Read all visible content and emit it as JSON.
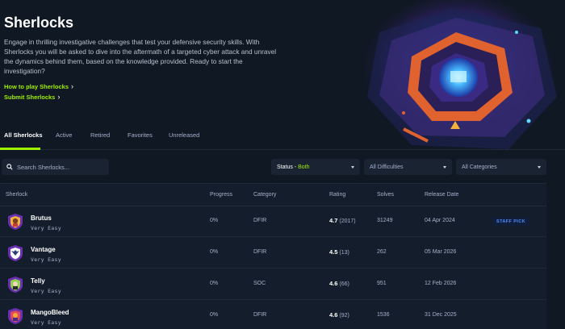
{
  "hero": {
    "title": "Sherlocks",
    "description": "Engage in thrilling investigative challenges that test your defensive security skills. With Sherlocks you will be asked to dive into the aftermath of a targeted cyber attack and unravel the dynamics behind them, based on the knowledge provided. Ready to start the investigation?",
    "links": [
      {
        "label": "How to play Sherlocks"
      },
      {
        "label": "Submit Sherlocks"
      }
    ]
  },
  "tabs": [
    {
      "label": "All Sherlocks",
      "active": true
    },
    {
      "label": "Active"
    },
    {
      "label": "Retired"
    },
    {
      "label": "Favorites"
    },
    {
      "label": "Unreleased"
    }
  ],
  "filters": {
    "search_placeholder": "Search Sherlocks...",
    "status_label": "Status",
    "status_separator": " - ",
    "status_value": "Both",
    "difficulty": "All Difficulties",
    "category": "All Categories"
  },
  "table": {
    "columns": [
      "Sherlock",
      "Progress",
      "Category",
      "Rating",
      "Solves",
      "Release Date"
    ],
    "rows": [
      {
        "name": "Brutus",
        "difficulty": "Very Easy",
        "progress": "0%",
        "category": "DFIR",
        "rating": "4.7",
        "rating_count": "(2017)",
        "solves": "31249",
        "release": "04 Apr 2024",
        "badge": "STAFF PICK",
        "avatar_color": "#6b2fb3"
      },
      {
        "name": "Vantage",
        "difficulty": "Very Easy",
        "progress": "0%",
        "category": "DFIR",
        "rating": "4.5",
        "rating_count": "(13)",
        "solves": "262",
        "release": "05 Mar 2026",
        "avatar_color": "#6b2fb3"
      },
      {
        "name": "Telly",
        "difficulty": "Very Easy",
        "progress": "0%",
        "category": "SOC",
        "rating": "4.6",
        "rating_count": "(66)",
        "solves": "951",
        "release": "12 Feb 2026",
        "avatar_color": "#6b2fb3"
      },
      {
        "name": "MangoBleed",
        "difficulty": "Very Easy",
        "progress": "0%",
        "category": "DFIR",
        "rating": "4.6",
        "rating_count": "(92)",
        "solves": "1536",
        "release": "31 Dec 2025",
        "avatar_color": "#6b2fb3"
      }
    ]
  },
  "colors": {
    "accent": "#9fef00",
    "background": "#101823",
    "table_bg": "#141d2b",
    "badge_text": "#4f8cff"
  },
  "icons": [
    "search-icon",
    "chevron-right-icon",
    "caret-down-icon",
    "shield-avatar-icon"
  ]
}
